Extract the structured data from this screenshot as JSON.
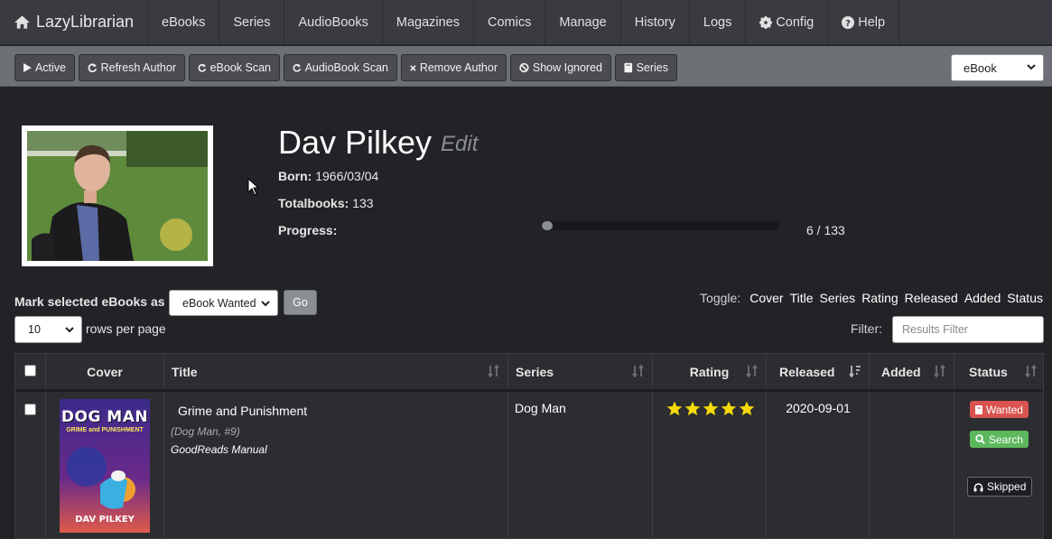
{
  "brand": "LazyLibrarian",
  "nav": [
    "eBooks",
    "Series",
    "AudioBooks",
    "Magazines",
    "Comics",
    "Manage",
    "History",
    "Logs",
    "Config",
    "Help"
  ],
  "toolbar": {
    "active": "Active",
    "refresh_author": "Refresh Author",
    "ebook_scan": "eBook Scan",
    "audiobook_scan": "AudioBook Scan",
    "remove_author": "Remove Author",
    "show_ignored": "Show Ignored",
    "series": "Series",
    "type_select": "eBook"
  },
  "author": {
    "name": "Dav Pilkey",
    "edit": "Edit",
    "born_label": "Born:",
    "born": "1966/03/04",
    "totalbooks_label": "Totalbooks:",
    "totalbooks": "133",
    "progress_label": "Progress:",
    "progress_text": "6 / 133",
    "progress_fraction": 0.045
  },
  "controls": {
    "mark_label": "Mark selected eBooks as",
    "mark_select": "eBook Wanted",
    "go": "Go",
    "rows_select": "10",
    "rows_label": "rows per page",
    "toggle_label": "Toggle:",
    "toggles": [
      "Cover",
      "Title",
      "Series",
      "Rating",
      "Released",
      "Added",
      "Status"
    ],
    "filter_label": "Filter:",
    "filter_placeholder": "Results Filter"
  },
  "table": {
    "headers": {
      "cover": "Cover",
      "title": "Title",
      "series": "Series",
      "rating": "Rating",
      "released": "Released",
      "added": "Added",
      "status": "Status"
    },
    "rows": [
      {
        "cover_title": "DOG MAN",
        "cover_subtitle": "GRIME and PUNISHMENT",
        "cover_author": "DAV PILKEY",
        "title": "Grime and Punishment",
        "series_note": "(Dog Man, #9)",
        "source": "GoodReads Manual",
        "series": "Dog Man",
        "rating": 5,
        "released": "2020-09-01",
        "added": "",
        "status_wanted": "Wanted",
        "status_search": "Search",
        "status_skipped": "Skipped"
      }
    ]
  },
  "colors": {
    "wanted": "#d9534f",
    "search": "#5cb85c",
    "star": "#f5d90a"
  }
}
